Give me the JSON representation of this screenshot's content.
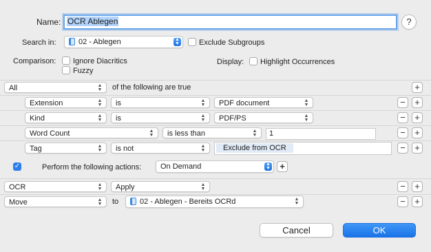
{
  "header": {
    "name_label": "Name:",
    "name_value": "OCR Ablegen",
    "help": "?",
    "search_in_label": "Search in:",
    "search_in_value": "02 - Ablegen",
    "exclude_subgroups": {
      "label": "Exclude Subgroups",
      "checked": false
    },
    "comparison_label": "Comparison:",
    "ignore_diacritics": {
      "label": "Ignore Diacritics",
      "checked": false
    },
    "fuzzy": {
      "label": "Fuzzy",
      "checked": false
    },
    "display_label": "Display:",
    "highlight_occurrences": {
      "label": "Highlight Occurrences",
      "checked": false
    }
  },
  "conditions": {
    "match_mode": "All",
    "match_text": "of the following are true",
    "rows": [
      {
        "field": "Extension",
        "operator": "is",
        "value": "PDF document"
      },
      {
        "field": "Kind",
        "operator": "is",
        "value": "PDF/PS"
      },
      {
        "field": "Word Count",
        "operator": "is less than",
        "value": "1"
      },
      {
        "field": "Tag",
        "operator": "is not",
        "value": "Exclude from OCR"
      }
    ]
  },
  "actions": {
    "perform_checked": true,
    "perform_label": "Perform the following actions:",
    "trigger": "On Demand",
    "rows": [
      {
        "action": "OCR",
        "mode": "Apply"
      },
      {
        "action": "Move",
        "to_label": "to",
        "destination": "02 - Ablegen - Bereits OCRd"
      }
    ]
  },
  "footer": {
    "cancel": "Cancel",
    "ok": "OK"
  },
  "glyphs": {
    "plus": "+",
    "minus": "−",
    "check": "✓",
    "chev_up": "▲",
    "chev_down": "▼"
  },
  "colors": {
    "accent": "#1a73e8",
    "focus_ring": "#6aa3e8",
    "selection": "#b3d4fc"
  }
}
